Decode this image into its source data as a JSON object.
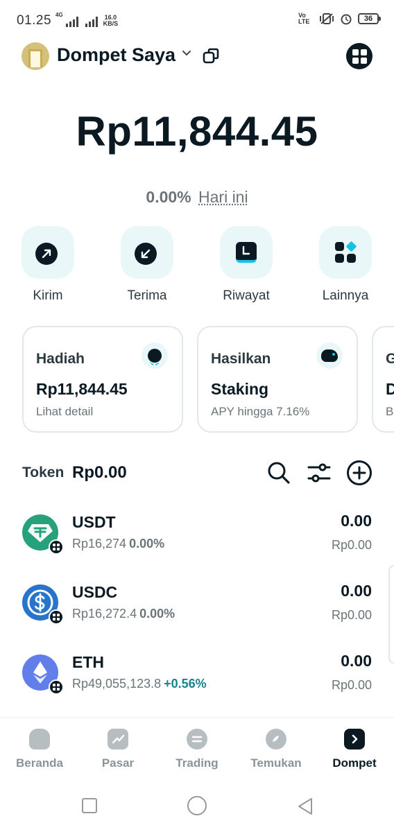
{
  "status_bar": {
    "time": "01.25",
    "net_type": "4G",
    "speed_value": "16.0",
    "speed_unit": "KB/S",
    "volte": "Vo LTE",
    "battery": "36"
  },
  "header": {
    "wallet_name": "Dompet Saya",
    "icons": [
      "wallet-avatar-icon",
      "chevron-down-icon",
      "copy-icon",
      "apps-grid-icon"
    ]
  },
  "balance": {
    "amount": "Rp11,844.45",
    "change_pct": "0.00%",
    "change_period": "Hari ini"
  },
  "actions": [
    {
      "label": "Kirim",
      "icon": "send-arrow-icon"
    },
    {
      "label": "Terima",
      "icon": "receive-arrow-icon"
    },
    {
      "label": "Riwayat",
      "icon": "history-clock-icon"
    },
    {
      "label": "Lainnya",
      "icon": "more-grid-icon"
    }
  ],
  "cards": [
    {
      "title": "Hadiah",
      "value": "Rp11,844.45",
      "sub": "Lihat detail",
      "icon": "reward-icon"
    },
    {
      "title": "Hasilkan",
      "value": "Staking",
      "sub": "APY hingga 7.16%",
      "icon": "piggy-bank-icon"
    },
    {
      "title": "G",
      "value": "D",
      "sub": "B"
    }
  ],
  "tokens_header": {
    "label": "Token",
    "total": "Rp0.00"
  },
  "tokens": [
    {
      "symbol": "USDT",
      "price": "Rp16,274",
      "change": "0.00%",
      "amount": "0.00",
      "fiat": "Rp0.00",
      "color": "#26a17b"
    },
    {
      "symbol": "USDC",
      "price": "Rp16,272.4",
      "change": "0.00%",
      "amount": "0.00",
      "fiat": "Rp0.00",
      "color": "#2775ca"
    },
    {
      "symbol": "ETH",
      "price": "Rp49,055,123.8",
      "change": "+0.56%",
      "amount": "0.00",
      "fiat": "Rp0.00",
      "color": "#627eea"
    }
  ],
  "bottom_nav": [
    {
      "label": "Beranda",
      "icon": "home-icon"
    },
    {
      "label": "Pasar",
      "icon": "market-chart-icon"
    },
    {
      "label": "Trading",
      "icon": "swap-icon"
    },
    {
      "label": "Temukan",
      "icon": "compass-icon"
    },
    {
      "label": "Dompet",
      "icon": "wallet-icon",
      "active": true
    }
  ],
  "colors": {
    "primary_dark": "#0b1a22",
    "accent": "#14c4e2",
    "positive": "#16838f",
    "muted": "#6b7478"
  }
}
